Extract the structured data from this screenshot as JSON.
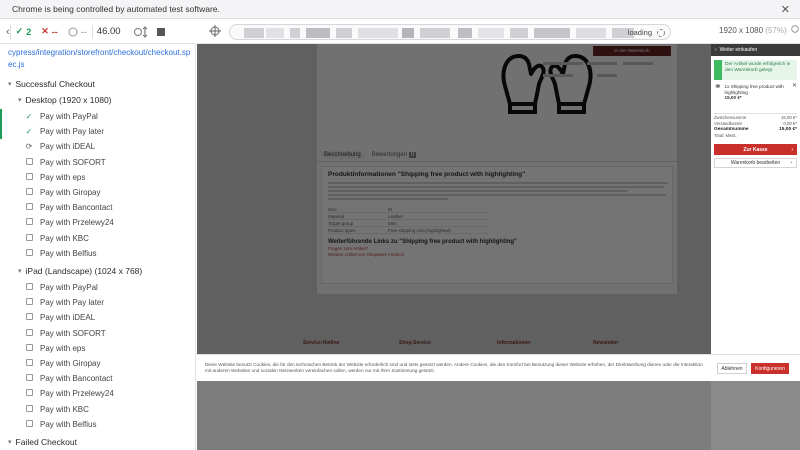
{
  "chrome_banner": {
    "text": "Chrome is being controlled by automated test software.",
    "close": "✕"
  },
  "reporter_header": {
    "back_icon": "‹",
    "passed": "2",
    "passed_icon": "✓",
    "failed": "--",
    "failed_icon": "✕",
    "pending": "--",
    "duration": "46.00"
  },
  "aut_toolbar": {
    "url_status": "loading",
    "viewport": "1920 x 1080",
    "scale": "(57%)"
  },
  "spec_path": "cypress/integration/storefront/checkout/checkout.spec.js",
  "suites": {
    "root": "Successful Checkout",
    "desktop": "Desktop (1920 x 1080)",
    "ipad": "iPad (Landscape) (1024 x 768)",
    "failed": "Failed Checkout"
  },
  "desktop_tests": [
    {
      "label": "Pay with PayPal",
      "state": "passed"
    },
    {
      "label": "Pay with Pay later",
      "state": "passed"
    },
    {
      "label": "Pay with iDEAL",
      "state": "running"
    },
    {
      "label": "Pay with SOFORT",
      "state": "pending"
    },
    {
      "label": "Pay with eps",
      "state": "pending"
    },
    {
      "label": "Pay with Giropay",
      "state": "pending"
    },
    {
      "label": "Pay with Bancontact",
      "state": "pending"
    },
    {
      "label": "Pay with Przelewy24",
      "state": "pending"
    },
    {
      "label": "Pay with KBC",
      "state": "pending"
    },
    {
      "label": "Pay with Belfius",
      "state": "pending"
    }
  ],
  "ipad_tests": [
    {
      "label": "Pay with PayPal",
      "state": "pending"
    },
    {
      "label": "Pay with Pay later",
      "state": "pending"
    },
    {
      "label": "Pay with iDEAL",
      "state": "pending"
    },
    {
      "label": "Pay with SOFORT",
      "state": "pending"
    },
    {
      "label": "Pay with eps",
      "state": "pending"
    },
    {
      "label": "Pay with Giropay",
      "state": "pending"
    },
    {
      "label": "Pay with Bancontact",
      "state": "pending"
    },
    {
      "label": "Pay with Przelewy24",
      "state": "pending"
    },
    {
      "label": "Pay with KBC",
      "state": "pending"
    },
    {
      "label": "Pay with Belfius",
      "state": "pending"
    }
  ],
  "product_page": {
    "buy_button": "In den Warenkorb",
    "tabs": [
      "Beschreibung",
      "Bewertungen"
    ],
    "reviews_count": "0",
    "desc_title": "Produktinformationen \"Shipping free product with highlighting\"",
    "properties": [
      [
        "Size",
        "M"
      ],
      [
        "Material",
        "Leather"
      ],
      [
        "Target group",
        "Men"
      ],
      [
        "Product types",
        "Free shipping cost (highlighted)"
      ]
    ],
    "links_title": "Weiterführende Links zu \"Shipping free product with highlighting\"",
    "links": [
      "Fragen zum Artikel?",
      "Weitere Artikel von Shopware Fashion"
    ],
    "footer_heads": [
      "Service-Hotline",
      "Shop-Service",
      "Informationen",
      "Newsletter"
    ]
  },
  "offcanvas": {
    "header": "Weiter einkaufen",
    "success": "Der Artikel wurde erfolgreich in den Warenkorb gelegt.",
    "item_qty": "1x",
    "item_name": "Shipping free product with highlighting",
    "item_price": "15,00 €*",
    "subtotal_label": "Zwischensumme",
    "subtotal": "15,00 €*",
    "shipping_label": "Versandkosten",
    "shipping": "0,00 €*",
    "total_label": "Gesamtsumme",
    "total": "15,00 €*",
    "tax_note": "Total: Mwst.",
    "checkout": "Zur Kasse",
    "edit": "Warenkorb bearbeiten"
  },
  "cookie": {
    "text": "Diese Website benutzt Cookies, die für den technischen Betrieb der Website erforderlich sind und stets gesetzt werden. Andere Cookies, die den Komfort bei Benutzung dieser Website erhöhen, der Direktwerbung dienen oder die Interaktion mit anderen Websites und sozialen Netzwerken vereinfachen sollen, werden nur mit Ihrer Zustimmung gesetzt.",
    "decline": "Ablehnen",
    "configure": "Konfigurieren"
  }
}
